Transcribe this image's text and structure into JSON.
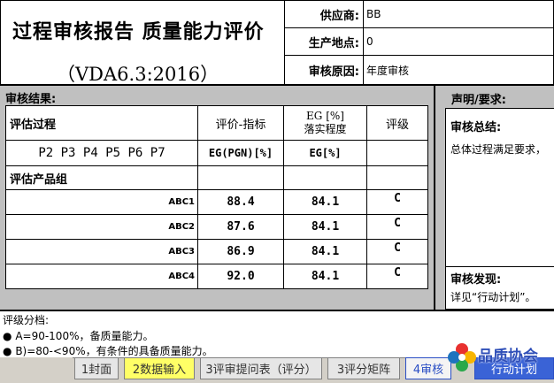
{
  "header": {
    "title": "过程审核报告  质量能力评价",
    "subtitle": "（VDA6.3:2016）",
    "supplier_label": "供应商:",
    "supplier_value": "BB",
    "location_label": "生产地点:",
    "location_value": "0",
    "reason_label": "审核原因:",
    "reason_value": "年度审核"
  },
  "results": {
    "section_title": "审核结果:",
    "col_process": "评估过程",
    "col_rating": "评价-指标",
    "col_eg_line1": "EG [%]",
    "col_eg_line2": "落实程度",
    "col_grade": "评级",
    "process_list": "P2 P3 P4 P5 P6 P7",
    "eg_pgn": "EG(PGN)[%]",
    "eg_pct": "EG[%]",
    "product_group_label": "评估产品组",
    "rows": [
      {
        "name": "ABC1",
        "rating": "88.4",
        "eg": "84.1",
        "grade": "C"
      },
      {
        "name": "ABC2",
        "rating": "87.6",
        "eg": "84.1",
        "grade": "C"
      },
      {
        "name": "ABC3",
        "rating": "86.9",
        "eg": "84.1",
        "grade": "C"
      },
      {
        "name": "ABC4",
        "rating": "92.0",
        "eg": "84.1",
        "grade": "C"
      }
    ]
  },
  "right": {
    "statement_title": "声明/要求:",
    "summary_title": "审核总结:",
    "summary_text": "总体过程满足要求，",
    "findings_title": "审核发现:",
    "findings_text": "详见“行动计划”。"
  },
  "grading": {
    "title": "评级分档:",
    "item_a": "A=90-100%，备质量能力。",
    "item_b": "B)=80-<90%，有条件的具备质量能力。"
  },
  "tabs": {
    "t1": "1封面",
    "t2": "2数据输入",
    "t3": "3评审提问表（评分）",
    "t4": "3评分矩阵",
    "t5": "4审核",
    "t6": "行动计划"
  },
  "logo": {
    "text": "品质协会",
    "colors": [
      "#e8312f",
      "#f7b500",
      "#2aa84a",
      "#1e73be"
    ]
  },
  "colors": {
    "active_tab": "#ffff66",
    "selected_tab": "#3a63d6",
    "section_bg": "#c0c0c0"
  }
}
